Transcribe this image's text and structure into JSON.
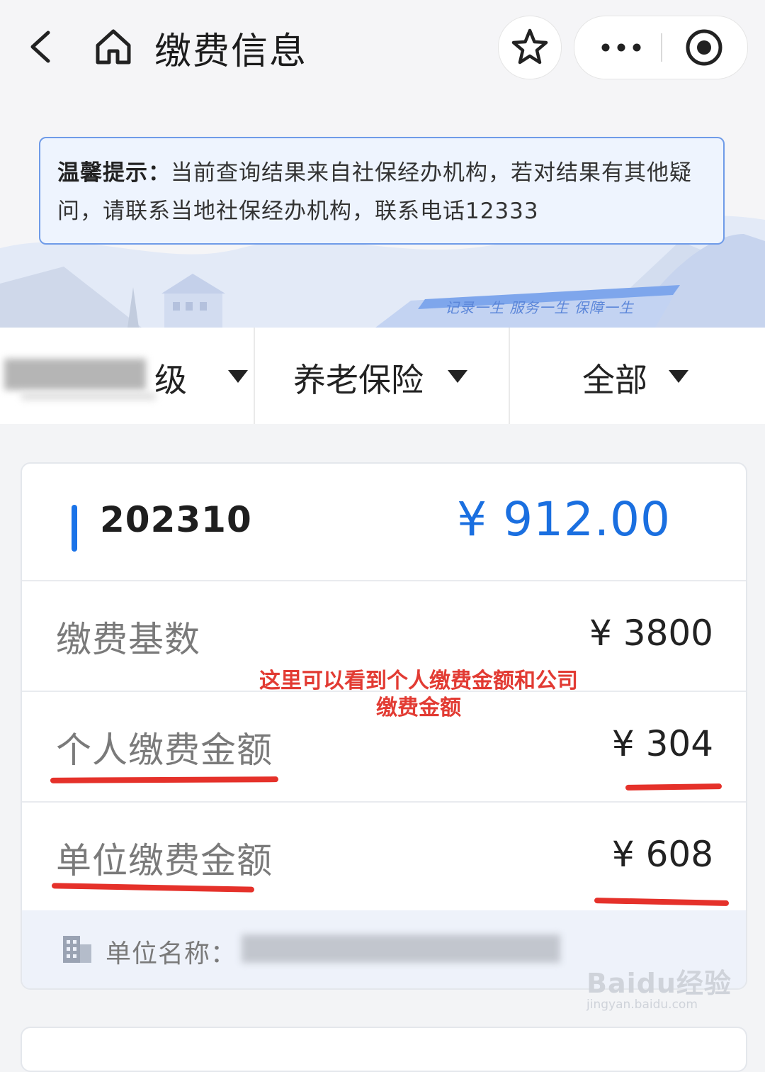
{
  "nav": {
    "title": "缴费信息",
    "icons": [
      "back-icon",
      "home-icon",
      "star-icon",
      "more-icon",
      "close-target-icon"
    ]
  },
  "tip": {
    "label": "温馨提示：",
    "text": "当前查询结果来自社保经办机构，若对结果有其他疑问，请联系当地社保经办机构，联系电话12333"
  },
  "banner": {
    "slogan": "记录一生 服务一生 保障一生"
  },
  "filters": {
    "region_suffix": "级",
    "insurance": "养老保险",
    "range": "全部"
  },
  "record": {
    "period": "202310",
    "total": "¥ 912.00",
    "rows": [
      {
        "label": "缴费基数",
        "value": "¥ 3800"
      },
      {
        "label": "个人缴费金额",
        "value": "¥ 304"
      },
      {
        "label": "单位缴费金额",
        "value": "¥ 608"
      }
    ],
    "annotation_line1": "这里可以看到个人缴费金额和公司",
    "annotation_line2": "缴费金额",
    "unit_label": "单位名称："
  },
  "watermark": {
    "brand": "Baidu经验",
    "url": "jingyan.baidu.com"
  },
  "colors": {
    "accent": "#1a73e8",
    "annotation": "#e23b33",
    "total": "#1a6fe0"
  }
}
